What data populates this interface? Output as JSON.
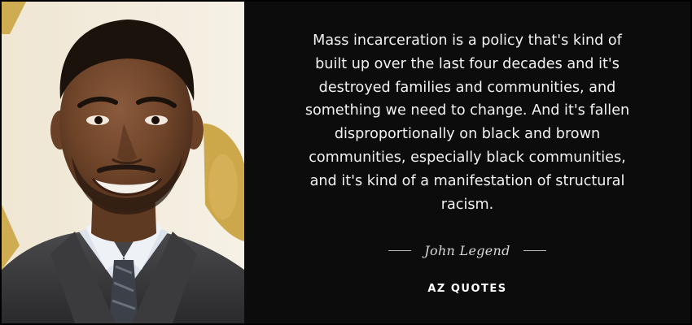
{
  "quote": {
    "lines": [
      "Mass incarceration is a policy that's kind of",
      "built up over the last four decades and it's",
      "destroyed families and communities, and",
      "something we need to change. And it's fallen",
      "disproportionally on black and brown",
      "communities, especially black communities,",
      "and it's kind of a manifestation of structural",
      "racism."
    ],
    "author": "John Legend",
    "brand": "AZ QUOTES"
  },
  "photo": {
    "subject": "portrait of smiling man in suit"
  },
  "colors": {
    "background": "#0c0c0c",
    "text": "#f2f2f2",
    "backdrop_gold": "#c9a03a"
  }
}
